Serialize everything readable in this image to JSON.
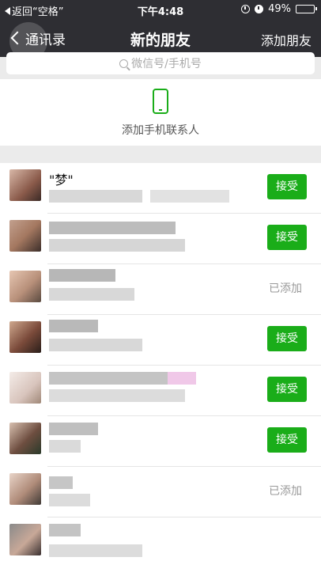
{
  "status_bar": {
    "back_app": "返回“空格”",
    "time": "下午4:48",
    "battery": "49%",
    "battery_level": 0.49
  },
  "nav": {
    "back_label": "通讯录",
    "title": "新的朋友",
    "action_label": "添加朋友"
  },
  "search": {
    "placeholder": "微信号/手机号"
  },
  "add_contacts": {
    "label": "添加手机联系人"
  },
  "friends": [
    {
      "name": "\"梦\"",
      "status": "接受",
      "type": "accept"
    },
    {
      "name": "",
      "status": "接受",
      "type": "accept"
    },
    {
      "name": "",
      "status": "已添加",
      "type": "added"
    },
    {
      "name": "",
      "status": "接受",
      "type": "accept"
    },
    {
      "name": "",
      "status": "接受",
      "type": "accept"
    },
    {
      "name": "",
      "status": "接受",
      "type": "accept"
    },
    {
      "name": "",
      "status": "已添加",
      "type": "added"
    },
    {
      "name": "",
      "status": "",
      "type": "none"
    }
  ],
  "colors": {
    "accent": "#1aad19",
    "navbar": "#2e2e33"
  }
}
